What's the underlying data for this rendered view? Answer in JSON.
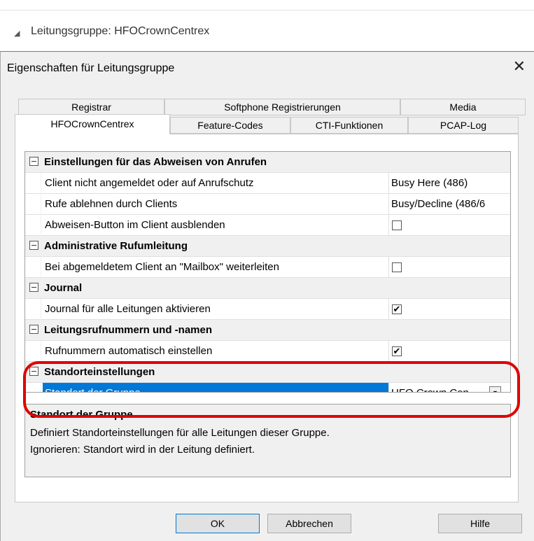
{
  "tree": {
    "arrow": "◢",
    "label": "Leitungsgruppe: HFOCrownCentrex"
  },
  "dialog": {
    "title": "Eigenschaften für Leitungsgruppe",
    "close": "✕"
  },
  "tabs": {
    "row_back": [
      "Registrar",
      "Softphone Registrierungen",
      "Media"
    ],
    "row_front": [
      "HFOCrownCentrex",
      "Feature-Codes",
      "CTI-Funktionen",
      "PCAP-Log"
    ]
  },
  "grid": {
    "categories": [
      {
        "name": "Einstellungen für das Abweisen von Anrufen",
        "items": [
          {
            "name": "Client nicht angemeldet oder auf Anrufschutz",
            "value": "Busy Here (486)"
          },
          {
            "name": "Rufe ablehnen durch Clients",
            "value": "Busy/Decline (486/6"
          },
          {
            "name": "Abweisen-Button im Client ausblenden",
            "checked": false
          }
        ]
      },
      {
        "name": "Administrative Rufumleitung",
        "items": [
          {
            "name": "Bei abgemeldetem Client an \"Mailbox\" weiterleiten",
            "checked": false
          }
        ]
      },
      {
        "name": "Journal",
        "items": [
          {
            "name": "Journal für alle Leitungen aktivieren",
            "checked": true
          }
        ]
      },
      {
        "name": "Leitungsrufnummern und -namen",
        "items": [
          {
            "name": "Rufnummern automatisch einstellen",
            "checked": true
          }
        ]
      },
      {
        "name": "Standorteinstellungen",
        "items": [
          {
            "name": "Standort der Gruppe",
            "value": "HFO Crown Cen",
            "selected": true
          }
        ]
      }
    ],
    "check_mark": "✔",
    "dropdown_arrow": "▾"
  },
  "description": {
    "title": "Standort der Gruppe",
    "lines": [
      "Definiert Standorteinstellungen für alle Leitungen dieser Gruppe.",
      "Ignorieren: Standort wird in der Leitung definiert."
    ]
  },
  "buttons": {
    "ok": "OK",
    "cancel": "Abbrechen",
    "help": "Hilfe"
  },
  "colors": {
    "selection": "#0078d7",
    "highlight": "#e00000"
  }
}
